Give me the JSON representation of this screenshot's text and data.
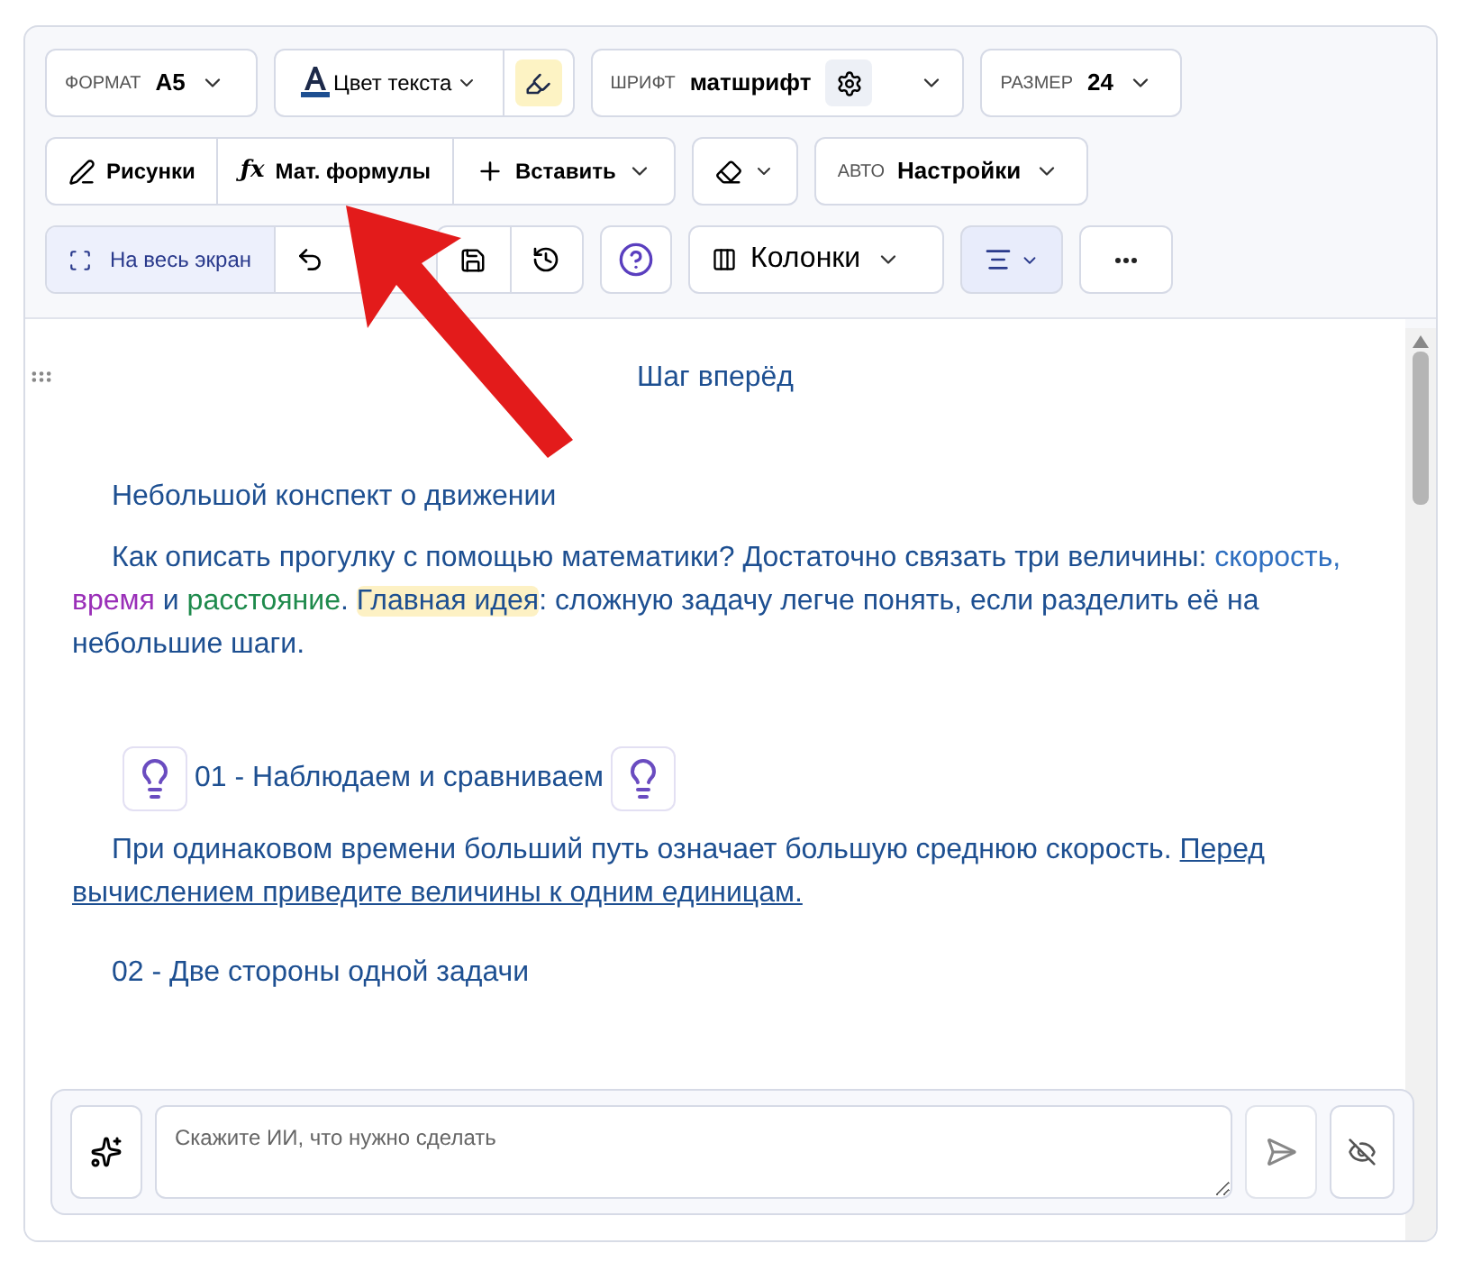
{
  "toolbar": {
    "format": {
      "label": "ФОРМАТ",
      "value": "A5"
    },
    "text_color": {
      "label": "Цвет текста"
    },
    "font": {
      "label": "ШРИФТ",
      "value": "матшрифт"
    },
    "size": {
      "label": "РАЗМЕР",
      "value": "24"
    },
    "insert_group": [
      {
        "kind": "drawings",
        "label": "Рисунки"
      },
      {
        "kind": "formula",
        "icon_text": "ƒx",
        "label": "Мат. формулы"
      },
      {
        "kind": "insert",
        "label": "Вставить"
      }
    ],
    "auto": {
      "label": "АВТО",
      "value": "Настройки"
    },
    "fullscreen": {
      "label": "На весь экран",
      "selected": true
    },
    "columns": {
      "label": "Колонки"
    },
    "align": {
      "selected": true
    }
  },
  "document": {
    "title": "Шаг вперёд",
    "blocks": [
      {
        "kind": "heading",
        "text": "Небольшой конспект о движении"
      },
      {
        "kind": "paragraph",
        "parts": [
          {
            "kind": "plain",
            "text": "Как описать прогулку с помощью математики? Достаточно связать три величины: "
          },
          {
            "kind": "colored",
            "text": "скорость, ",
            "color": "#2f6fc0"
          },
          {
            "kind": "colored",
            "text": "время",
            "color": "#9a2fb8"
          },
          {
            "kind": "plain",
            "text": " и "
          },
          {
            "kind": "colored",
            "text": "расстояние",
            "color": "#1e8a4c"
          },
          {
            "kind": "plain",
            "text": ". "
          },
          {
            "kind": "highlight",
            "text": "Главная идея"
          },
          {
            "kind": "plain",
            "text": ": сложную задачу легче понять, если разделить её на небольшие шаги."
          }
        ]
      },
      {
        "kind": "icon_heading",
        "text": "01 - Наблюдаем и сравниваем"
      },
      {
        "kind": "paragraph",
        "parts": [
          {
            "kind": "plain",
            "text": "При одинаковом времени больший путь означает большую среднюю скорость. "
          },
          {
            "kind": "underline",
            "text": "Перед вычислением приведите величины к одним единицам."
          }
        ]
      },
      {
        "kind": "heading",
        "text": "02 - Две стороны одной задачи"
      }
    ]
  },
  "ai_prompt": {
    "placeholder": "Скажите ИИ, что нужно сделать"
  }
}
